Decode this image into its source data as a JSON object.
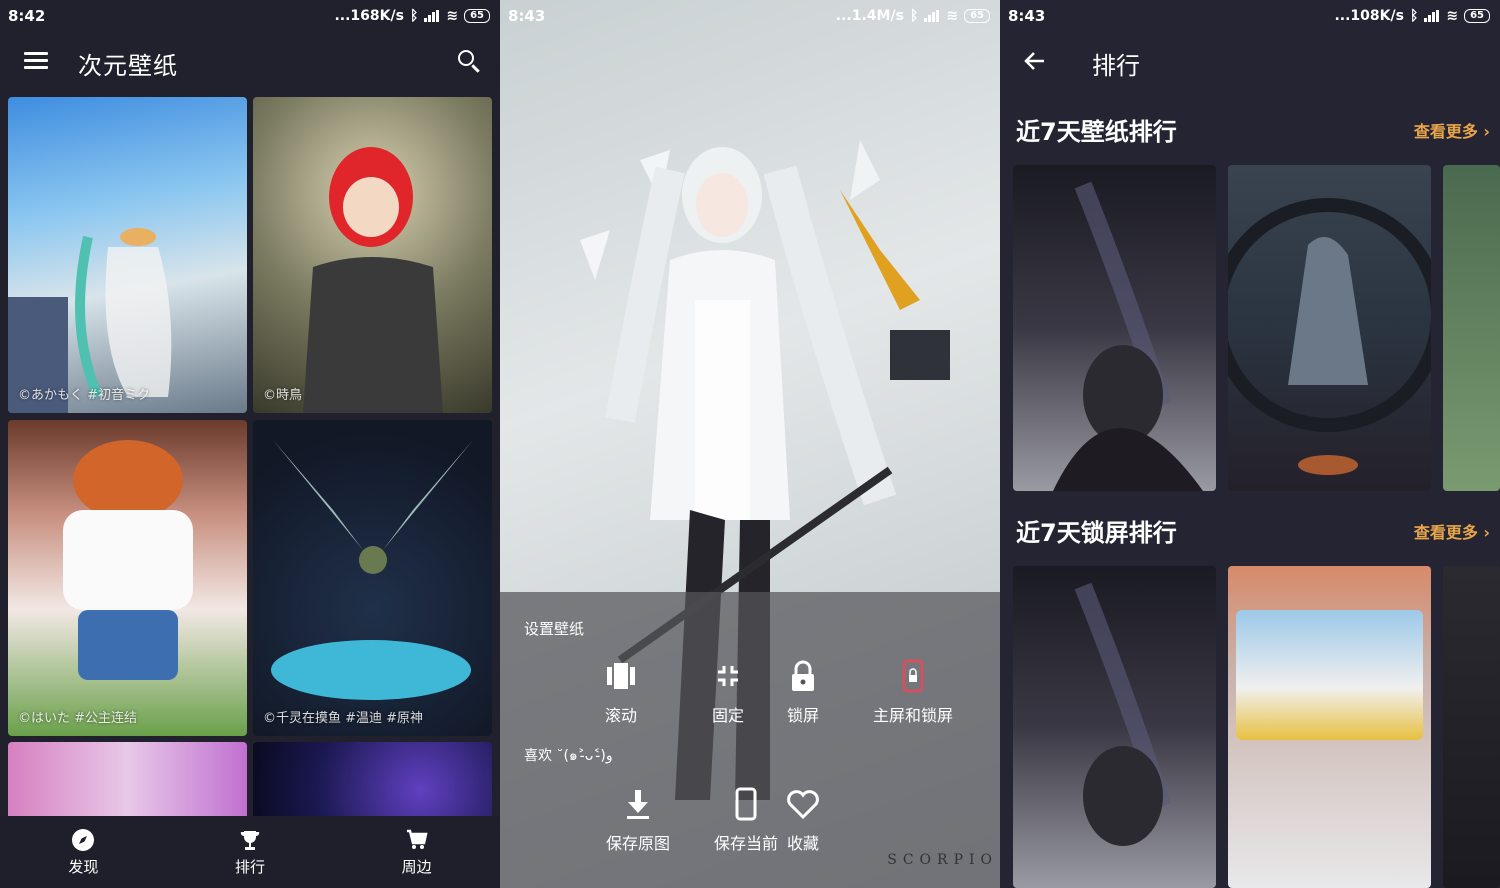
{
  "screen1": {
    "status": {
      "time": "8:42",
      "speed": "...168K/s",
      "battery": "65"
    },
    "app_title": "次元壁纸",
    "wallpapers": [
      {
        "credit": "©あかもく #初音ミク"
      },
      {
        "credit": "©時鳥"
      },
      {
        "credit": "©はいた #公主连结"
      },
      {
        "credit": "©千灵在摸鱼 #温迪 #原神"
      },
      {
        "credit": ""
      },
      {
        "credit": ""
      }
    ],
    "nav": [
      {
        "label": "发现",
        "icon": "compass-icon"
      },
      {
        "label": "排行",
        "icon": "trophy-icon"
      },
      {
        "label": "周边",
        "icon": "cart-icon"
      }
    ]
  },
  "screen2": {
    "status": {
      "time": "8:43",
      "speed": "...1.4M/s",
      "battery": "65"
    },
    "sheet_title": "设置壁纸",
    "set_actions": [
      {
        "label": "滚动",
        "icon": "scroll-icon"
      },
      {
        "label": "固定",
        "icon": "fixed-icon"
      },
      {
        "label": "锁屏",
        "icon": "lock-icon"
      },
      {
        "label": "主屏和锁屏",
        "icon": "phone-lock-icon"
      }
    ],
    "like_text": "喜欢 ˘(๑˃̵ᴗ˂̵)و",
    "save_actions": [
      {
        "label": "保存原图",
        "icon": "download-icon"
      },
      {
        "label": "保存当前",
        "icon": "phone-icon"
      },
      {
        "label": "收藏",
        "icon": "heart-icon"
      }
    ],
    "watermark": "SCORPIO"
  },
  "screen3": {
    "status": {
      "time": "8:43",
      "speed": "...108K/s",
      "battery": "65"
    },
    "title": "排行",
    "sections": [
      {
        "title": "近7天壁纸排行",
        "more": "查看更多 ›"
      },
      {
        "title": "近7天锁屏排行",
        "more": "查看更多 ›"
      }
    ]
  },
  "colors": {
    "accent": "#e8a64a",
    "background": "#21212e"
  }
}
